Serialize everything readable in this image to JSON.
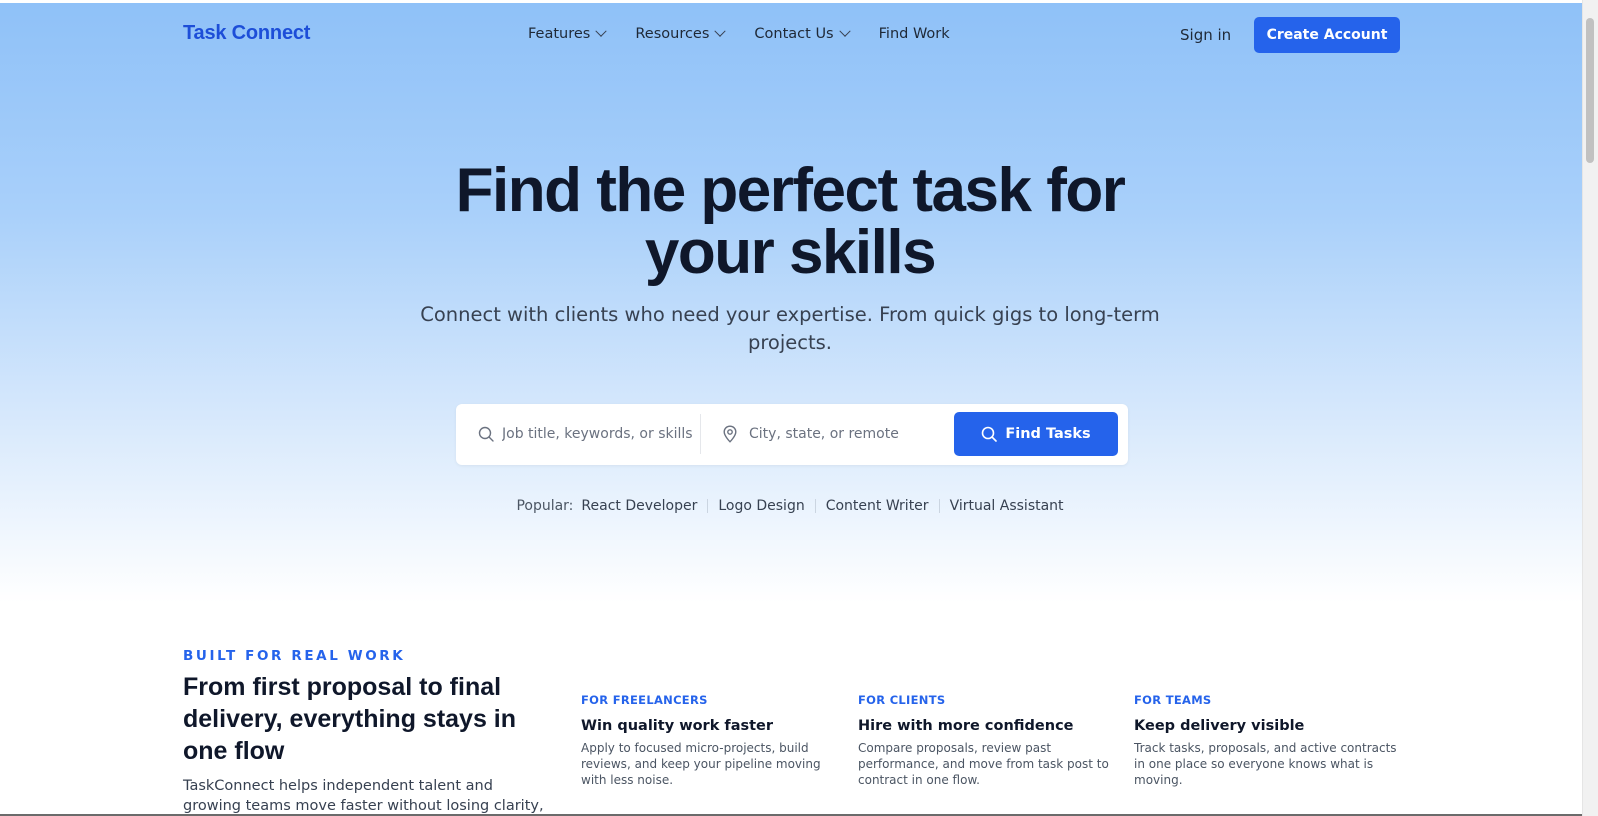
{
  "brand": {
    "logo": "Task Connect",
    "accent": "#2563eb"
  },
  "nav": {
    "items": [
      {
        "label": "Features",
        "has_dropdown": true
      },
      {
        "label": "Resources",
        "has_dropdown": true
      },
      {
        "label": "Contact Us",
        "has_dropdown": true
      },
      {
        "label": "Find Work",
        "has_dropdown": false
      }
    ],
    "signin": "Sign in",
    "create_account": "Create Account"
  },
  "hero": {
    "headline_line1": "Find the perfect task for",
    "headline_line2": "your skills",
    "subhead": "Connect with clients who need your expertise. From quick gigs to long-term projects."
  },
  "search": {
    "keywords_placeholder": "Job title, keywords, or skills",
    "location_placeholder": "City, state, or remote",
    "button": "Find Tasks"
  },
  "popular": {
    "label": "Popular:",
    "tags": [
      "React Developer",
      "Logo Design",
      "Content Writer",
      "Virtual Assistant"
    ]
  },
  "section": {
    "eyebrow": "BUILT FOR REAL WORK",
    "title": "From first proposal to final delivery, everything stays in one flow",
    "body": "TaskConnect helps independent talent and growing teams move faster without losing clarity, trust, or",
    "cards": [
      {
        "kicker": "FOR FREELANCERS",
        "title": "Win quality work faster",
        "desc": "Apply to focused micro-projects, build reviews, and keep your pipeline moving with less noise."
      },
      {
        "kicker": "FOR CLIENTS",
        "title": "Hire with more confidence",
        "desc": "Compare proposals, review past performance, and move from task post to contract in one flow."
      },
      {
        "kicker": "FOR TEAMS",
        "title": "Keep delivery visible",
        "desc": "Track tasks, proposals, and active contracts in one place so everyone knows what is moving."
      }
    ]
  }
}
